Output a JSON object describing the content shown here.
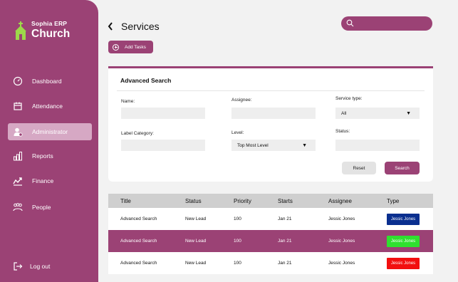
{
  "brand": {
    "erp": "Sophia ERP",
    "name": "Church",
    "icon": "church-icon"
  },
  "sidebar": {
    "items": [
      {
        "label": "Dashboard",
        "icon": "dashboard-icon",
        "active": false
      },
      {
        "label": "Attendance",
        "icon": "calendar-icon",
        "active": false
      },
      {
        "label": "Administrator",
        "icon": "admin-user-icon",
        "active": true
      },
      {
        "label": "Reports",
        "icon": "reports-icon",
        "active": false
      },
      {
        "label": "Finance",
        "icon": "finance-icon",
        "active": false
      },
      {
        "label": "People",
        "icon": "people-icon",
        "active": false
      }
    ],
    "logout": {
      "label": "Log out",
      "icon": "logout-icon"
    }
  },
  "header": {
    "title": "Services",
    "search_placeholder": "",
    "add_tasks_label": "Add Tasks"
  },
  "advanced_search": {
    "title": "Advanced Search",
    "name_label": "Name:",
    "name_value": "",
    "assignee_label": "Assignee:",
    "assignee_value": "",
    "service_type_label": "Service type:",
    "service_type_value": "All",
    "label_category_label": "Label Category:",
    "label_category_value": "",
    "level_label": "Level:",
    "level_value": "Top Most Level",
    "status_label": "Status:",
    "status_value": "",
    "reset_label": "Reset",
    "search_label": "Search"
  },
  "table": {
    "headers": [
      "Title",
      "Status",
      "Priority",
      "Starts",
      "Assignee",
      "Type"
    ],
    "rows": [
      {
        "title": "Advanced Search",
        "status": "New Lead",
        "priority": "100",
        "starts": "Jan 21",
        "assignee": "Jessic Jones",
        "type": "Jessic Jones",
        "type_color": "#0a2f8f",
        "highlight": false
      },
      {
        "title": "Advanced Search",
        "status": "New Lead",
        "priority": "100",
        "starts": "Jan 21",
        "assignee": "Jessic Jones",
        "type": "Jessic Jones",
        "type_color": "#2fe02f",
        "highlight": true
      },
      {
        "title": "Advanced Search",
        "status": "New Lead",
        "priority": "100",
        "starts": "Jan 21",
        "assignee": "Jessic Jones",
        "type": "Jessic Jones",
        "type_color": "#f20f0f",
        "highlight": false
      }
    ]
  },
  "colors": {
    "accent": "#9b4275",
    "active_nav": "#d6a8c4",
    "background": "#f2f2f2"
  }
}
